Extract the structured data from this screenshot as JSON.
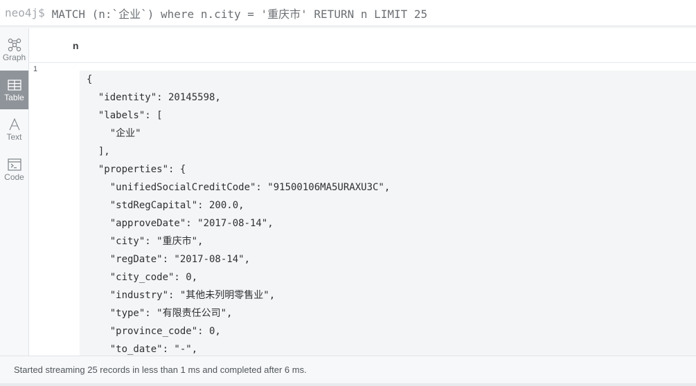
{
  "query_bar": {
    "prompt": "neo4j$",
    "query": "MATCH (n:`企业`) where n.city = '重庆市' RETURN n LIMIT 25"
  },
  "sidebar": {
    "items": [
      {
        "label": "Graph",
        "icon": "graph-icon",
        "active": false
      },
      {
        "label": "Table",
        "icon": "table-icon",
        "active": true
      },
      {
        "label": "Text",
        "icon": "text-icon",
        "active": false
      },
      {
        "label": "Code",
        "icon": "code-icon",
        "active": false
      }
    ]
  },
  "table": {
    "column": "n",
    "row_number": "1",
    "json_lines": [
      "{",
      "  \"identity\": 20145598,",
      "  \"labels\": [",
      "    \"企业\"",
      "  ],",
      "  \"properties\": {",
      "    \"unifiedSocialCreditCode\": \"91500106MA5URAXU3C\",",
      "    \"stdRegCapital\": 200.0,",
      "    \"approveDate\": \"2017-08-14\",",
      "    \"city\": \"重庆市\",",
      "    \"regDate\": \"2017-08-14\",",
      "    \"city_code\": 0,",
      "    \"industry\": \"其他未列明零售业\",",
      "    \"type\": \"有限责任公司\",",
      "    \"province_code\": 0,",
      "    \"to_date\": \"-\","
    ]
  },
  "status": {
    "text": "Started streaming 25 records in less than 1 ms and completed after 6 ms."
  },
  "colors": {
    "active_tab": "#8f949a",
    "sidebar_bg": "#f7f8f9",
    "cell_bg": "#f4f5f6"
  }
}
